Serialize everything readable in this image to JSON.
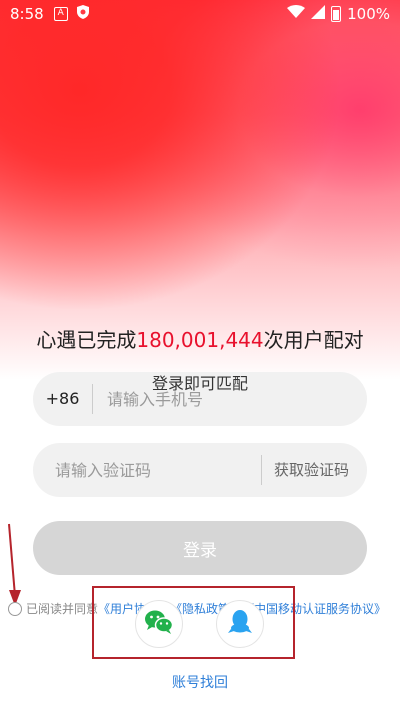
{
  "status_bar": {
    "time": "8:58",
    "icon1": "A",
    "battery_percent": "100%"
  },
  "headline": {
    "prefix": "心遇已完成",
    "count": "180,001,444",
    "suffix": "次用户配对"
  },
  "subline": "登录即可匹配",
  "phone": {
    "prefix": "+86",
    "placeholder": "请输入手机号"
  },
  "code": {
    "placeholder": "请输入验证码",
    "get_code_label": "获取验证码"
  },
  "login_label": "登录",
  "agreement": {
    "text": "已阅读并同意",
    "link1": "《用户协议》",
    "link2": "《隐私政策》",
    "link3": "《中国移动认证服务协议》"
  },
  "recover_label": "账号找回",
  "colors": {
    "accent": "#e8112d",
    "link": "#2f7fd8",
    "wechat": "#22b14c",
    "qq": "#2aa3f0"
  }
}
